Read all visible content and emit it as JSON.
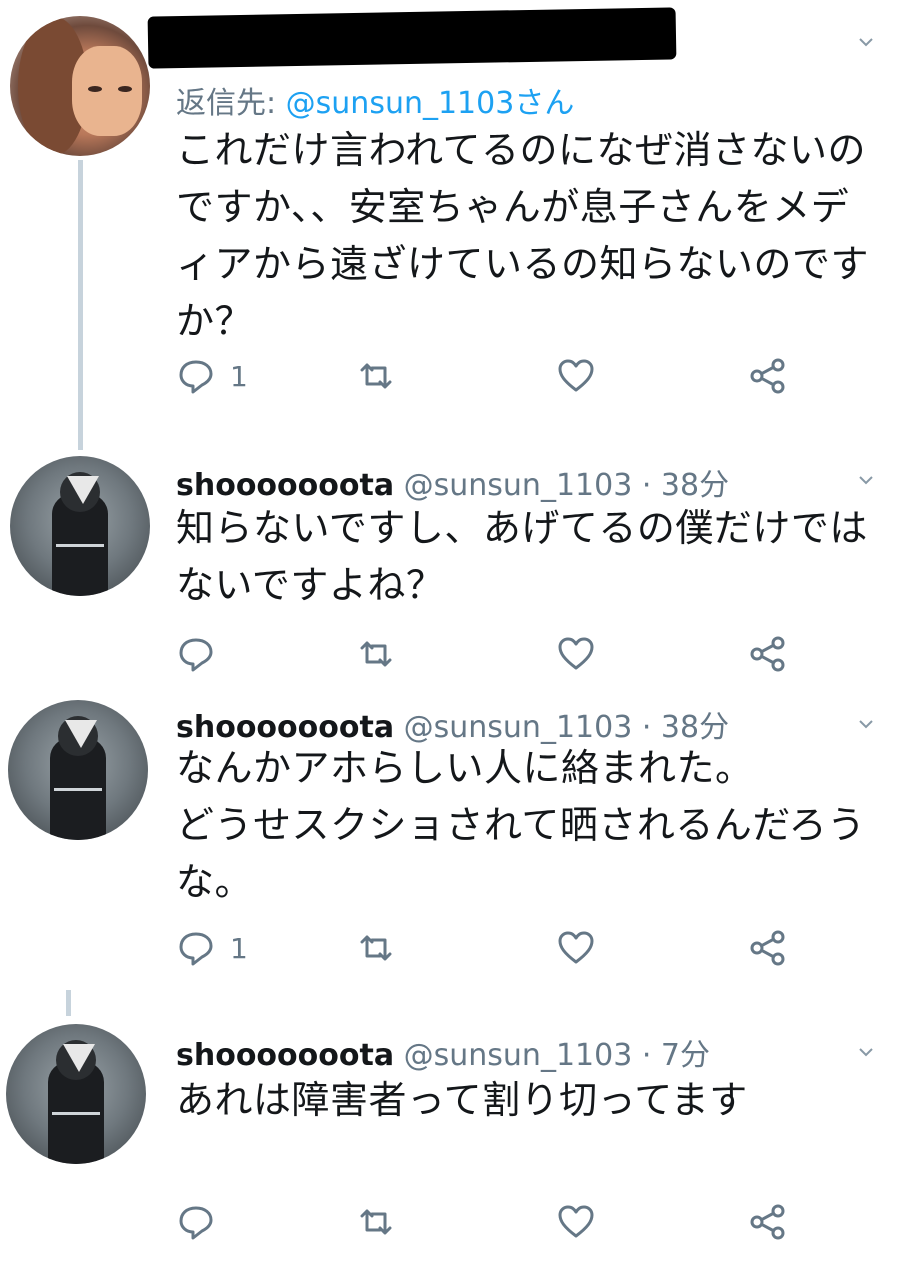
{
  "tweets": [
    {
      "reply_prefix": "返信先: ",
      "mention": "@sunsun_1103さん",
      "text": "これだけ言われてるのになぜ消さないの\nですか、、安室ちゃんが息子さんをメデ\nィアから遠ざけているの知らないのです\nか？",
      "reply_count": "1"
    },
    {
      "name": "shooooooota",
      "handle": "@sunsun_1103",
      "time": "· 38分",
      "text": "知らないですし、あげてるの僕だけでは\nないですよね？",
      "reply_count": ""
    },
    {
      "name": "shooooooota",
      "handle": "@sunsun_1103",
      "time": "· 38分",
      "text": "なんかアホらしい人に絡まれた。\nどうせスクショされて晒されるんだろう\nな。",
      "reply_count": "1"
    },
    {
      "name": "shooooooota",
      "handle": "@sunsun_1103",
      "time": "· 7分",
      "text": "あれは障害者って割り切ってます",
      "reply_count": ""
    }
  ],
  "icons": {
    "reply": "reply-icon",
    "retweet": "retweet-icon",
    "like": "heart-icon",
    "share": "share-icon",
    "more": "chevron-down-icon"
  },
  "colors": {
    "text": "#14171a",
    "muted": "#657786",
    "link": "#1da1f2",
    "thread_line": "#c7d3dc"
  }
}
